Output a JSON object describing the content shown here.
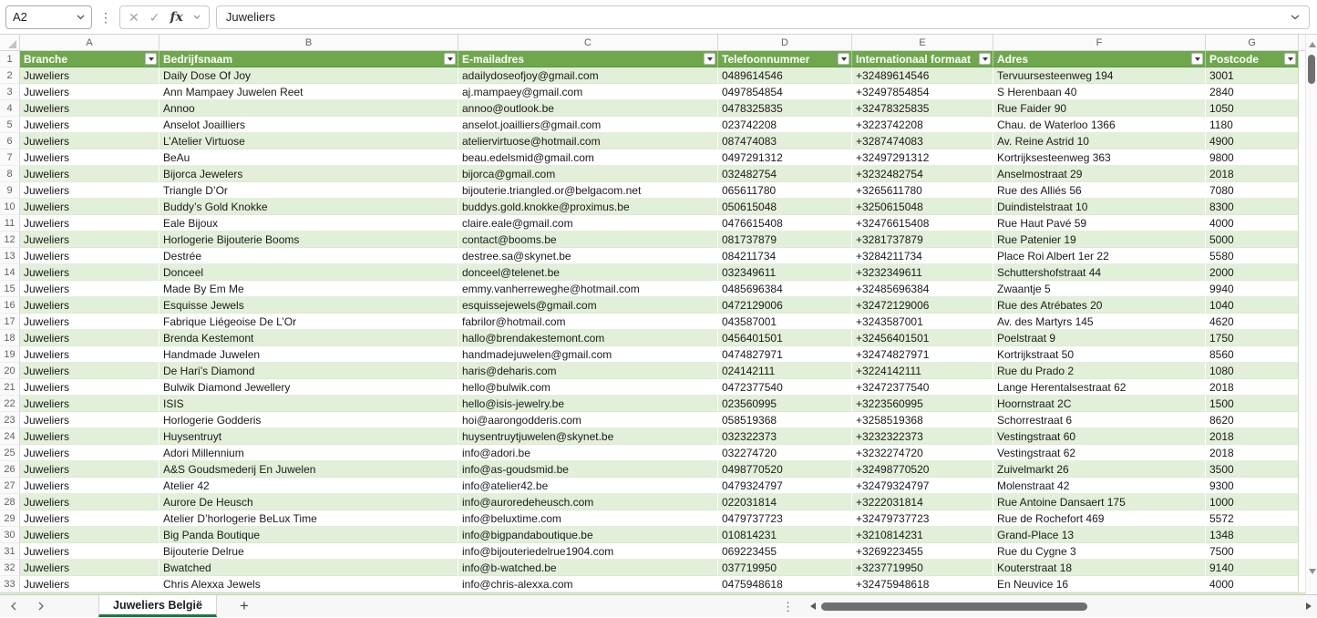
{
  "formula_bar": {
    "name_box": "A2",
    "cancel_glyph": "✕",
    "confirm_glyph": "✓",
    "fx_glyph": "fx",
    "formula": "Juweliers"
  },
  "icons": {
    "more_vertical": "⋮"
  },
  "grid": {
    "column_letters": [
      "A",
      "B",
      "C",
      "D",
      "E",
      "F",
      "G"
    ],
    "header_row_number": "1",
    "headers": [
      "Branche",
      "Bedrijfsnaam",
      "E-mailadres",
      "Telefoonnummer",
      "Internationaal formaat",
      "Adres",
      "Postcode"
    ],
    "rows": [
      [
        "Juweliers",
        "Daily Dose Of Joy",
        "adailydoseofjoy@gmail.com",
        "0489614546",
        "+32489614546",
        "Tervuursesteenweg 194",
        "3001"
      ],
      [
        "Juweliers",
        "Ann Mampaey Juwelen Reet",
        "aj.mampaey@gmail.com",
        "0497854854",
        "+32497854854",
        "S Herenbaan 40",
        "2840"
      ],
      [
        "Juweliers",
        "Annoo",
        "annoo@outlook.be",
        "0478325835",
        "+32478325835",
        "Rue Faider 90",
        "1050"
      ],
      [
        "Juweliers",
        "Anselot Joailliers",
        "anselot.joailliers@gmail.com",
        "023742208",
        "+3223742208",
        "Chau. de Waterloo 1366",
        "1180"
      ],
      [
        "Juweliers",
        "L’Atelier Virtuose",
        "ateliervirtuose@hotmail.com",
        "087474083",
        "+3287474083",
        "Av. Reine Astrid 10",
        "4900"
      ],
      [
        "Juweliers",
        "BeAu",
        "beau.edelsmid@gmail.com",
        "0497291312",
        "+32497291312",
        "Kortrijksesteenweg 363",
        "9800"
      ],
      [
        "Juweliers",
        "Bijorca Jewelers",
        "bijorca@gmail.com",
        "032482754",
        "+3232482754",
        "Anselmostraat 29",
        "2018"
      ],
      [
        "Juweliers",
        "Triangle D’Or",
        "bijouterie.triangled.or@belgacom.net",
        "065611780",
        "+3265611780",
        "Rue des Alliés 56",
        "7080"
      ],
      [
        "Juweliers",
        "Buddy’s Gold Knokke",
        "buddys.gold.knokke@proximus.be",
        "050615048",
        "+3250615048",
        "Duindistelstraat 10",
        "8300"
      ],
      [
        "Juweliers",
        "Eale Bijoux",
        "claire.eale@gmail.com",
        "0476615408",
        "+32476615408",
        "Rue Haut Pavé 59",
        "4000"
      ],
      [
        "Juweliers",
        "Horlogerie Bijouterie Booms",
        "contact@booms.be",
        "081737879",
        "+3281737879",
        "Rue Patenier 19",
        "5000"
      ],
      [
        "Juweliers",
        "Destrée",
        "destree.sa@skynet.be",
        "084211734",
        "+3284211734",
        "Place Roi Albert 1er 22",
        "5580"
      ],
      [
        "Juweliers",
        "Donceel",
        "donceel@telenet.be",
        "032349611",
        "+3232349611",
        "Schuttershofstraat 44",
        "2000"
      ],
      [
        "Juweliers",
        "Made By Em Me",
        "emmy.vanherreweghe@hotmail.com",
        "0485696384",
        "+32485696384",
        "Zwaantje 5",
        "9940"
      ],
      [
        "Juweliers",
        "Esquisse Jewels",
        "esquissejewels@gmail.com",
        "0472129006",
        "+32472129006",
        "Rue des Atrébates 20",
        "1040"
      ],
      [
        "Juweliers",
        "Fabrique Liégeoise De L’Or",
        "fabrilor@hotmail.com",
        "043587001",
        "+3243587001",
        "Av. des Martyrs 145",
        "4620"
      ],
      [
        "Juweliers",
        "Brenda Kestemont",
        "hallo@brendakestemont.com",
        "0456401501",
        "+32456401501",
        "Poelstraat 9",
        "1750"
      ],
      [
        "Juweliers",
        "Handmade Juwelen",
        "handmadejuwelen@gmail.com",
        "0474827971",
        "+32474827971",
        "Kortrijkstraat 50",
        "8560"
      ],
      [
        "Juweliers",
        "De Hari’s Diamond",
        "haris@deharis.com",
        "024142111",
        "+3224142111",
        "Rue du Prado 2",
        "1080"
      ],
      [
        "Juweliers",
        "Bulwik Diamond Jewellery",
        "hello@bulwik.com",
        "0472377540",
        "+32472377540",
        "Lange Herentalsestraat 62",
        "2018"
      ],
      [
        "Juweliers",
        "ISIS",
        "hello@isis-jewelry.be",
        "023560995",
        "+3223560995",
        "Hoornstraat 2C",
        "1500"
      ],
      [
        "Juweliers",
        "Horlogerie Godderis",
        "hoi@aarongodderis.com",
        "058519368",
        "+3258519368",
        "Schorrestraat 6",
        "8620"
      ],
      [
        "Juweliers",
        "Huysentruyt",
        "huysentruytjuwelen@skynet.be",
        "032322373",
        "+3232322373",
        "Vestingstraat 60",
        "2018"
      ],
      [
        "Juweliers",
        "Adori Millennium",
        "info@adori.be",
        "032274720",
        "+3232274720",
        "Vestingstraat 62",
        "2018"
      ],
      [
        "Juweliers",
        "A&S Goudsmederij En Juwelen",
        "info@as-goudsmid.be",
        "0498770520",
        "+32498770520",
        "Zuivelmarkt 26",
        "3500"
      ],
      [
        "Juweliers",
        "Atelier 42",
        "info@atelier42.be",
        "0479324797",
        "+32479324797",
        "Molenstraat 42",
        "9300"
      ],
      [
        "Juweliers",
        "Aurore De Heusch",
        "info@auroredeheusch.com",
        "022031814",
        "+3222031814",
        "Rue Antoine Dansaert 175",
        "1000"
      ],
      [
        "Juweliers",
        "Atelier D’horlogerie BeLux Time",
        "info@beluxtime.com",
        "0479737723",
        "+32479737723",
        "Rue de Rochefort 469",
        "5572"
      ],
      [
        "Juweliers",
        "Big Panda Boutique",
        "info@bigpandaboutique.be",
        "010814231",
        "+3210814231",
        "Grand-Place 13",
        "1348"
      ],
      [
        "Juweliers",
        "Bijouterie Delrue",
        "info@bijouteriedelrue1904.com",
        "069223455",
        "+3269223455",
        "Rue du Cygne 3",
        "7500"
      ],
      [
        "Juweliers",
        "Bwatched",
        "info@b-watched.be",
        "037719950",
        "+3237719950",
        "Kouterstraat 18",
        "9140"
      ],
      [
        "Juweliers",
        "Chris Alexxa Jewels",
        "info@chris-alexxa.com",
        "0475948618",
        "+32475948618",
        "En Neuvice 16",
        "4000"
      ]
    ]
  },
  "sheet_bar": {
    "active_tab": "Juweliers België",
    "add_sheet_glyph": "+"
  },
  "colors": {
    "header_green": "#6FA84C",
    "band_green": "#E2EFD9",
    "tab_underline_green": "#1A7A41"
  }
}
